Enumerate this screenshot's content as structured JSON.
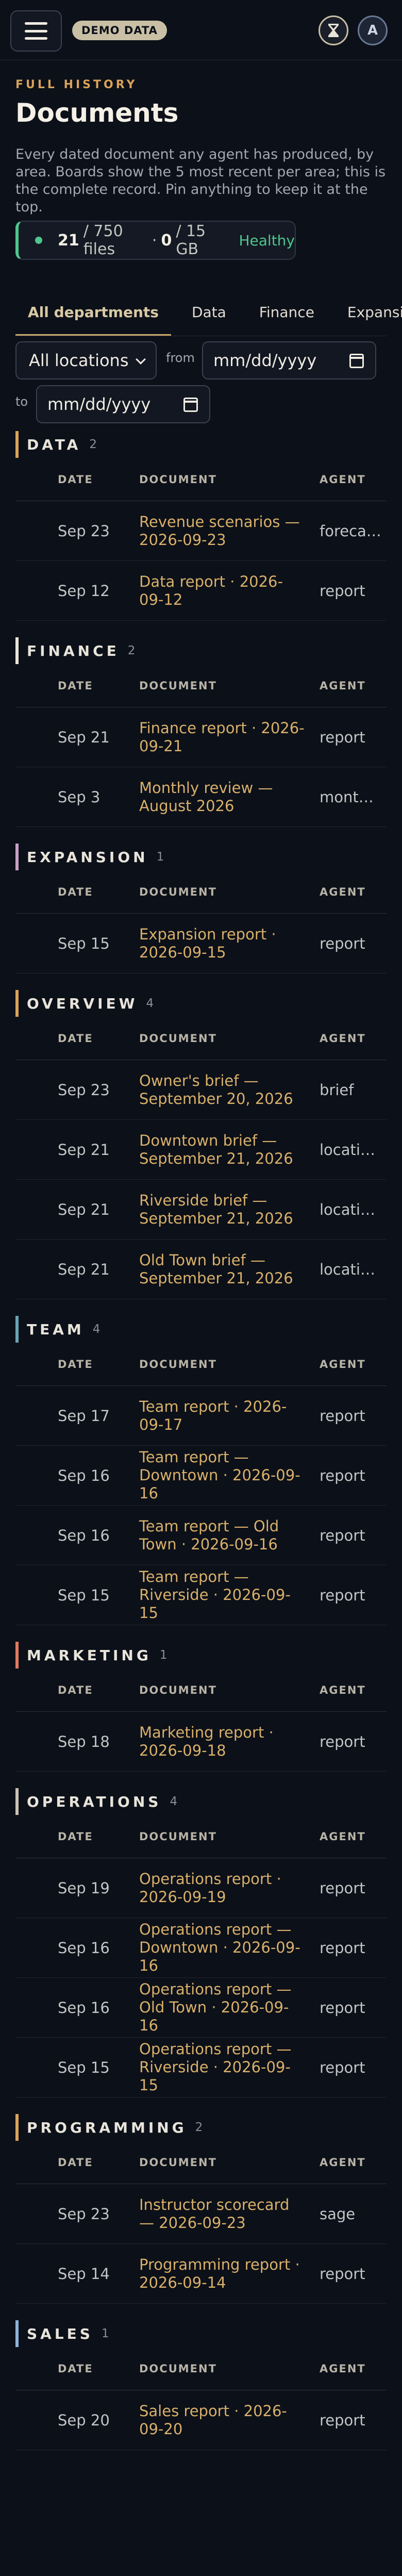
{
  "header": {
    "demo_badge": "DEMO DATA",
    "avatar_initial": "A"
  },
  "page": {
    "eyebrow": "FULL HISTORY",
    "title": "Documents",
    "intro": "Every dated document any agent has produced, by area. Boards show the 5 most recent per area; this is the complete record. Pin anything to keep it at the top."
  },
  "stats": {
    "files_count": "21",
    "files_total": "/ 750 files",
    "sep": "·",
    "storage_used": "0",
    "storage_total": "/ 15 GB",
    "health": "Healthy"
  },
  "tabs": [
    {
      "label": "All departments",
      "active": true
    },
    {
      "label": "Data",
      "active": false
    },
    {
      "label": "Finance",
      "active": false
    },
    {
      "label": "Expansion",
      "active": false
    }
  ],
  "filters": {
    "location": "All locations",
    "from_label": "from",
    "to_label": "to",
    "from_value": "mm/dd/yyyy",
    "to_value": "mm/dd/yyyy"
  },
  "columns": {
    "date": "DATE",
    "document": "DOCUMENT",
    "agent": "AGENT"
  },
  "accent_colors": {
    "data": "#d8a35a",
    "finance": "#e8e4da",
    "expansion": "#c9a0c6",
    "overview": "#d8a35a",
    "team": "#6aa3b4",
    "marketing": "#e07a5f",
    "operations": "#c9c2b4",
    "programming": "#d8a35a",
    "sales": "#8fb3d9"
  },
  "sections": [
    {
      "key": "data",
      "name": "DATA",
      "count": "2",
      "rows": [
        {
          "date": "Sep 23",
          "doc": "Revenue scenarios — 2026-09-23",
          "agent": "forecaster"
        },
        {
          "date": "Sep 12",
          "doc": "Data report · 2026-09-12",
          "agent": "report"
        }
      ]
    },
    {
      "key": "finance",
      "name": "FINANCE",
      "count": "2",
      "rows": [
        {
          "date": "Sep 21",
          "doc": "Finance report · 2026-09-21",
          "agent": "report"
        },
        {
          "date": "Sep 3",
          "doc": "Monthly review — August 2026",
          "agent": "monthly-review"
        }
      ]
    },
    {
      "key": "expansion",
      "name": "EXPANSION",
      "count": "1",
      "rows": [
        {
          "date": "Sep 15",
          "doc": "Expansion report · 2026-09-15",
          "agent": "report"
        }
      ]
    },
    {
      "key": "overview",
      "name": "OVERVIEW",
      "count": "4",
      "rows": [
        {
          "date": "Sep 23",
          "doc": "Owner's brief — September 20, 2026",
          "agent": "brief"
        },
        {
          "date": "Sep 21",
          "doc": "Downtown brief — September 21, 2026",
          "agent": "location-brief"
        },
        {
          "date": "Sep 21",
          "doc": "Riverside brief — September 21, 2026",
          "agent": "location-brief"
        },
        {
          "date": "Sep 21",
          "doc": "Old Town brief — September 21, 2026",
          "agent": "location-brief"
        }
      ]
    },
    {
      "key": "team",
      "name": "TEAM",
      "count": "4",
      "rows": [
        {
          "date": "Sep 17",
          "doc": "Team report · 2026-09-17",
          "agent": "report"
        },
        {
          "date": "Sep 16",
          "doc": "Team report — Downtown · 2026-09-16",
          "agent": "report"
        },
        {
          "date": "Sep 16",
          "doc": "Team report — Old Town · 2026-09-16",
          "agent": "report"
        },
        {
          "date": "Sep 15",
          "doc": "Team report — Riverside · 2026-09-15",
          "agent": "report"
        }
      ]
    },
    {
      "key": "marketing",
      "name": "MARKETING",
      "count": "1",
      "rows": [
        {
          "date": "Sep 18",
          "doc": "Marketing report · 2026-09-18",
          "agent": "report"
        }
      ]
    },
    {
      "key": "operations",
      "name": "OPERATIONS",
      "count": "4",
      "rows": [
        {
          "date": "Sep 19",
          "doc": "Operations report · 2026-09-19",
          "agent": "report"
        },
        {
          "date": "Sep 16",
          "doc": "Operations report — Downtown · 2026-09-16",
          "agent": "report"
        },
        {
          "date": "Sep 16",
          "doc": "Operations report — Old Town · 2026-09-16",
          "agent": "report"
        },
        {
          "date": "Sep 15",
          "doc": "Operations report — Riverside · 2026-09-15",
          "agent": "report"
        }
      ]
    },
    {
      "key": "programming",
      "name": "PROGRAMMING",
      "count": "2",
      "rows": [
        {
          "date": "Sep 23",
          "doc": "Instructor scorecard — 2026-09-23",
          "agent": "sage"
        },
        {
          "date": "Sep 14",
          "doc": "Programming report · 2026-09-14",
          "agent": "report"
        }
      ]
    },
    {
      "key": "sales",
      "name": "SALES",
      "count": "1",
      "rows": [
        {
          "date": "Sep 20",
          "doc": "Sales report · 2026-09-20",
          "agent": "report"
        }
      ]
    }
  ]
}
